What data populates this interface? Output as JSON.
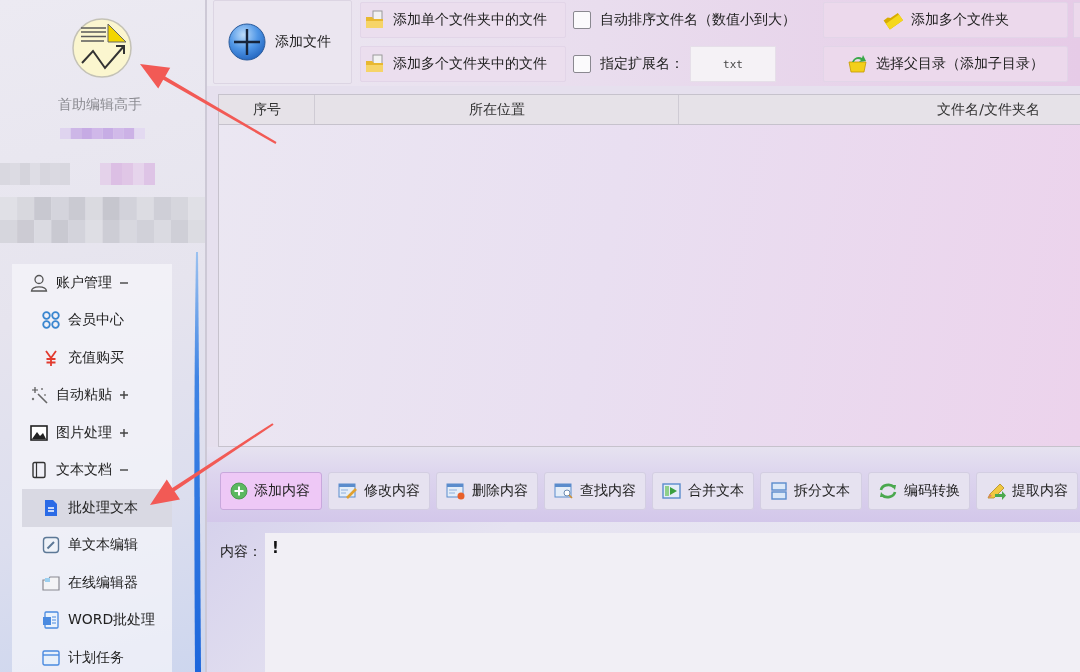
{
  "app": {
    "name": "首助编辑高手"
  },
  "sidebar": {
    "groups": [
      {
        "label": "账户管理",
        "expanded": true,
        "children": [
          {
            "label": "会员中心",
            "selected": false
          },
          {
            "label": "充值购买",
            "selected": false
          }
        ]
      },
      {
        "label": "自动粘贴",
        "expanded": false
      },
      {
        "label": "图片处理",
        "expanded": false
      },
      {
        "label": "文本文档",
        "expanded": true,
        "children": [
          {
            "label": "批处理文本",
            "selected": true
          },
          {
            "label": "单文本编辑",
            "selected": false
          },
          {
            "label": "在线编辑器",
            "selected": false
          },
          {
            "label": "WORD批处理",
            "selected": false
          },
          {
            "label": "计划任务",
            "selected": false
          }
        ]
      }
    ]
  },
  "toolbar": {
    "add_file": "添加文件",
    "folder_buttons": [
      "添加单个文件夹中的文件",
      "添加多个文件夹中的文件"
    ],
    "options": [
      {
        "label": "自动排序文件名（数值小到大）",
        "checked": false
      },
      {
        "label": "指定扩展名：",
        "checked": false,
        "value": "txt"
      }
    ],
    "dir_buttons": [
      "添加多个文件夹",
      "选择父目录（添加子目录）"
    ]
  },
  "table": {
    "columns": [
      "序号",
      "所在位置",
      "文件名/文件夹名"
    ]
  },
  "actions": [
    {
      "label": "添加内容",
      "selected": true
    },
    {
      "label": "修改内容",
      "selected": false
    },
    {
      "label": "删除内容",
      "selected": false
    },
    {
      "label": "查找内容",
      "selected": false
    },
    {
      "label": "合并文本",
      "selected": false
    },
    {
      "label": "拆分文本",
      "selected": false
    },
    {
      "label": "编码转换",
      "selected": false
    },
    {
      "label": "提取内容",
      "selected": false
    }
  ],
  "content": {
    "label": "内容：",
    "value": "!"
  }
}
